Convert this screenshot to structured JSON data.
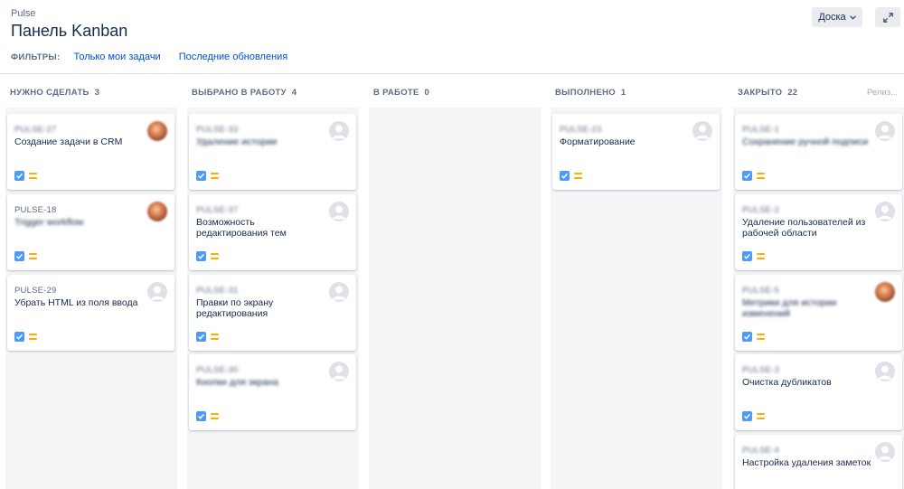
{
  "header": {
    "project": "Pulse",
    "title": "Панель Kanban",
    "board_button": "Доска",
    "filters_label": "ФИЛЬТРЫ:",
    "filters": [
      "Только мои задачи",
      "Последние обновления"
    ]
  },
  "release_label": "Релиз...",
  "colors": {
    "accent": "#0052cc",
    "story_type": "#4c9aff",
    "priority_medium": "#ffab00",
    "column_bg": "#f4f5f7"
  },
  "columns": [
    {
      "name": "НУЖНО СДЕЛАТЬ",
      "count": "3",
      "cards": [
        {
          "key": "PULSE-27",
          "summary": "Создание задачи в CRM",
          "key_blurred": true,
          "summary_blurred": false,
          "avatar": "photo"
        },
        {
          "key": "PULSE-18",
          "summary": "Trigger workflow",
          "key_blurred": false,
          "summary_blurred": true,
          "avatar": "photo"
        },
        {
          "key": "PULSE-29",
          "summary": "Убрать HTML из поля ввода",
          "key_blurred": false,
          "summary_blurred": false,
          "avatar": "gray"
        }
      ]
    },
    {
      "name": "ВЫБРАНО В РАБОТУ",
      "count": "4",
      "cards": [
        {
          "key": "PULSE-33",
          "summary": "Удаление истории",
          "key_blurred": true,
          "summary_blurred": true,
          "avatar": "gray"
        },
        {
          "key": "PULSE-37",
          "summary": "Возможность редактирования тем",
          "key_blurred": true,
          "summary_blurred": false,
          "avatar": "gray"
        },
        {
          "key": "PULSE-31",
          "summary": "Правки по экрану редактирования",
          "key_blurred": true,
          "summary_blurred": false,
          "avatar": "gray"
        },
        {
          "key": "PULSE-30",
          "summary": "Кнопки для экрана",
          "key_blurred": true,
          "summary_blurred": true,
          "avatar": "gray"
        }
      ]
    },
    {
      "name": "В РАБОТЕ",
      "count": "0",
      "cards": []
    },
    {
      "name": "ВЫПОЛНЕНО",
      "count": "1",
      "cards": [
        {
          "key": "PULSE-23",
          "summary": "Форматирование",
          "key_blurred": true,
          "summary_blurred": false,
          "avatar": "gray"
        }
      ]
    },
    {
      "name": "ЗАКРЫТО",
      "count": "22",
      "cards": [
        {
          "key": "PULSE-1",
          "summary": "Сохранение ручной подписи",
          "key_blurred": true,
          "summary_blurred": true,
          "avatar": "gray"
        },
        {
          "key": "PULSE-2",
          "summary": "Удаление пользователей из рабочей области",
          "key_blurred": true,
          "summary_blurred": false,
          "avatar": "gray"
        },
        {
          "key": "PULSE-5",
          "summary": "Метрики для истории изменений",
          "key_blurred": true,
          "summary_blurred": true,
          "avatar": "photo"
        },
        {
          "key": "PULSE-3",
          "summary": "Очистка дубликатов",
          "key_blurred": true,
          "summary_blurred": false,
          "avatar": "gray"
        },
        {
          "key": "PULSE-4",
          "summary": "Настройка удаления заметок",
          "key_blurred": true,
          "summary_blurred": false,
          "avatar": "gray"
        }
      ]
    }
  ]
}
